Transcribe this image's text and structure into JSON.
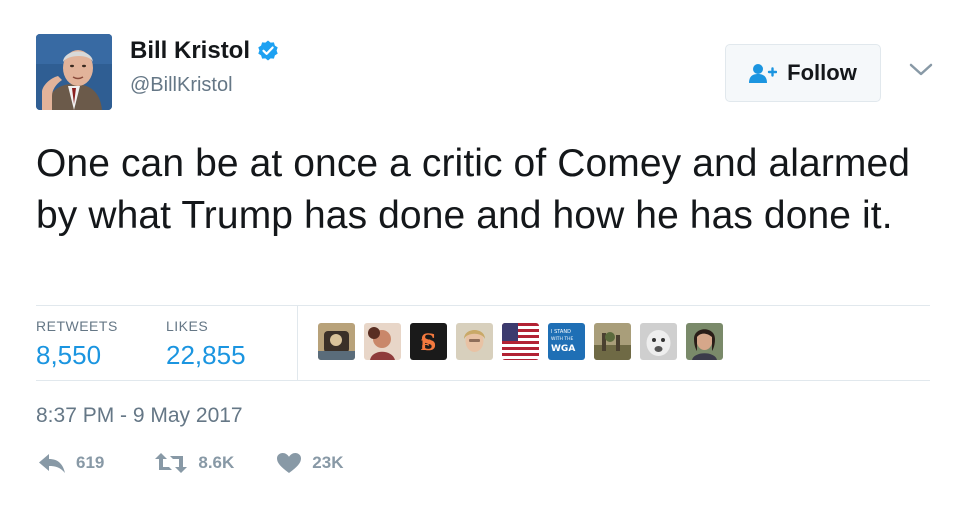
{
  "author": {
    "name": "Bill Kristol",
    "handle": "@BillKristol",
    "verified": true
  },
  "follow_button": {
    "label": "Follow",
    "icon": "add-person-icon"
  },
  "menu_icon": "chevron-down-icon",
  "tweet": {
    "text": "One can be at once a critic of Comey and alarmed by what Trump has done and how he has done it."
  },
  "stats": {
    "retweets_label": "RETWEETS",
    "retweets_value": "8,550",
    "likes_label": "LIKES",
    "likes_value": "22,855"
  },
  "likers": [
    {
      "name": "liker-avatar-1"
    },
    {
      "name": "liker-avatar-2"
    },
    {
      "name": "liker-avatar-giants-logo"
    },
    {
      "name": "liker-avatar-4"
    },
    {
      "name": "liker-avatar-us-flag"
    },
    {
      "name": "liker-avatar-wga",
      "text": "I STAND WITH THE WGA"
    },
    {
      "name": "liker-avatar-7"
    },
    {
      "name": "liker-avatar-8"
    },
    {
      "name": "liker-avatar-9"
    }
  ],
  "timestamp": "8:37 PM - 9 May 2017",
  "actions": {
    "reply_count": "619",
    "retweet_count": "8.6K",
    "like_count": "23K"
  },
  "colors": {
    "accent": "#1b95e0",
    "verified": "#1da1f2",
    "muted": "#657786",
    "icon": "#8899a6"
  }
}
